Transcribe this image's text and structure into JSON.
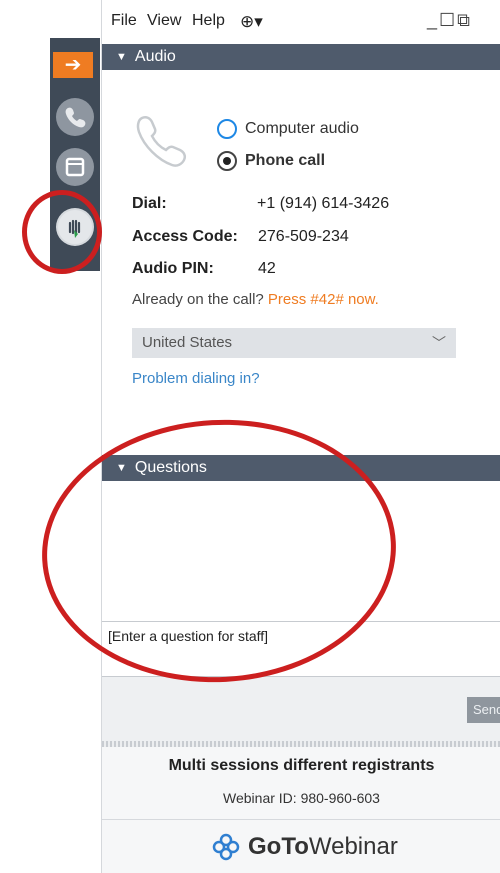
{
  "menubar": {
    "items": [
      "File",
      "View",
      "Help"
    ],
    "window_controls": "_☐⧉"
  },
  "sidebar": {
    "icons": [
      "arrow-right-icon",
      "phone-icon",
      "screen-icon",
      "raise-hand-icon"
    ]
  },
  "audio": {
    "header": "Audio",
    "options": [
      "Computer audio",
      "Phone call"
    ],
    "selected": "Phone call",
    "dial_label": "Dial:",
    "dial_value": "+1 (914) 614-3426",
    "access_label": "Access Code:",
    "access_value": "276-509-234",
    "pin_label": "Audio PIN:",
    "pin_value": "42",
    "already_text": "Already on the call?",
    "press_text": "Press #42# now.",
    "country": "United States",
    "problem_link": "Problem dialing in?"
  },
  "questions": {
    "header": "Questions",
    "placeholder": "[Enter a question for staff]",
    "send_label": "Send"
  },
  "footer": {
    "session_title": "Multi sessions different registrants",
    "webinar_id": "Webinar ID: 980-960-603",
    "brand_bold": "GoTo",
    "brand_rest": "Webinar"
  },
  "colors": {
    "header_bg": "#4f5b6c",
    "accent_orange": "#ef7c22",
    "link_blue": "#3a86c8",
    "annotation_red": "#cc1f1f"
  }
}
